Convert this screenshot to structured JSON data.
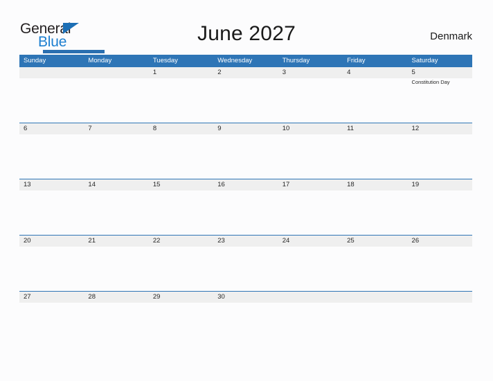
{
  "brand": {
    "name_top": "General",
    "name_bottom": "Blue",
    "flag_icon": "blue-triangle-flag-icon",
    "accent_color": "#2a6fb0"
  },
  "header": {
    "title": "June 2027",
    "country": "Denmark"
  },
  "theme": {
    "header_blue": "#2e75b6",
    "band_gray": "#efefef",
    "page_background": "#fcfcfd",
    "text_color": "#262626"
  },
  "calendar": {
    "month": "June",
    "year": "2027",
    "day_names": [
      "Sunday",
      "Monday",
      "Tuesday",
      "Wednesday",
      "Thursday",
      "Friday",
      "Saturday"
    ],
    "weeks": [
      [
        {
          "num": "",
          "event": ""
        },
        {
          "num": "",
          "event": ""
        },
        {
          "num": "1",
          "event": ""
        },
        {
          "num": "2",
          "event": ""
        },
        {
          "num": "3",
          "event": ""
        },
        {
          "num": "4",
          "event": ""
        },
        {
          "num": "5",
          "event": "Constitution Day"
        }
      ],
      [
        {
          "num": "6",
          "event": ""
        },
        {
          "num": "7",
          "event": ""
        },
        {
          "num": "8",
          "event": ""
        },
        {
          "num": "9",
          "event": ""
        },
        {
          "num": "10",
          "event": ""
        },
        {
          "num": "11",
          "event": ""
        },
        {
          "num": "12",
          "event": ""
        }
      ],
      [
        {
          "num": "13",
          "event": ""
        },
        {
          "num": "14",
          "event": ""
        },
        {
          "num": "15",
          "event": ""
        },
        {
          "num": "16",
          "event": ""
        },
        {
          "num": "17",
          "event": ""
        },
        {
          "num": "18",
          "event": ""
        },
        {
          "num": "19",
          "event": ""
        }
      ],
      [
        {
          "num": "20",
          "event": ""
        },
        {
          "num": "21",
          "event": ""
        },
        {
          "num": "22",
          "event": ""
        },
        {
          "num": "23",
          "event": ""
        },
        {
          "num": "24",
          "event": ""
        },
        {
          "num": "25",
          "event": ""
        },
        {
          "num": "26",
          "event": ""
        }
      ],
      [
        {
          "num": "27",
          "event": ""
        },
        {
          "num": "28",
          "event": ""
        },
        {
          "num": "29",
          "event": ""
        },
        {
          "num": "30",
          "event": ""
        },
        {
          "num": "",
          "event": ""
        },
        {
          "num": "",
          "event": ""
        },
        {
          "num": "",
          "event": ""
        }
      ]
    ]
  }
}
